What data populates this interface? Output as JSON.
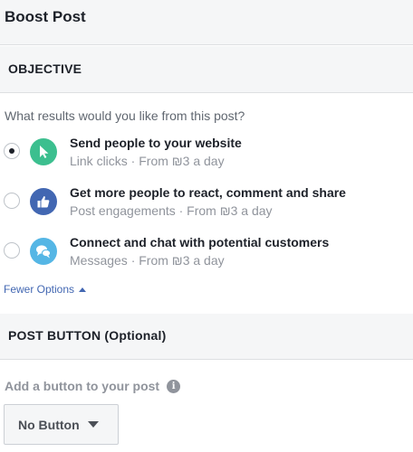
{
  "header": {
    "title": "Boost Post"
  },
  "objective": {
    "section_label": "OBJECTIVE",
    "question": "What results would you like from this post?",
    "options": [
      {
        "title": "Send people to your website",
        "subtitle": "Link clicks · From ₪3 a day",
        "icon": "cursor-icon",
        "color": "#3cbf8f",
        "selected": true
      },
      {
        "title": "Get more people to react, comment and share",
        "subtitle": "Post engagements · From ₪3 a day",
        "icon": "thumbs-up-icon",
        "color": "#4267b2",
        "selected": false
      },
      {
        "title": "Connect and chat with potential customers",
        "subtitle": "Messages · From ₪3 a day",
        "icon": "chat-bubbles-icon",
        "color": "#55b6e5",
        "selected": false
      }
    ],
    "fewer_options_label": "Fewer Options"
  },
  "post_button": {
    "section_label": "POST BUTTON (Optional)",
    "add_label": "Add a button to your post",
    "dropdown_value": "No Button"
  }
}
